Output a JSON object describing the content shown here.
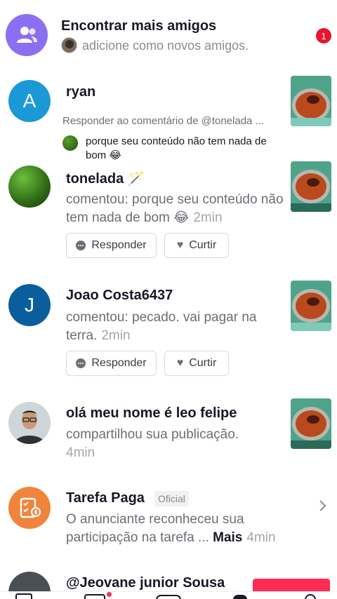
{
  "find_friends": {
    "title": "Encontrar mais amigos",
    "subtitle": "adicione como novos amigos.",
    "badge_count": "1",
    "accent": "#8c6ef2",
    "badge_color": "#e6162d"
  },
  "items": [
    {
      "letter": "A",
      "avatar_color": "#1b98d6",
      "name": "ryan",
      "context": "Responder ao comentário de @tonelada ...",
      "quote": "porque seu conteúdo não tem nada de bom 😂"
    },
    {
      "name": "tonelada 🪄",
      "comment": "comentou: porque seu conteúdo não tem nada de bom 😂",
      "time": "2min",
      "reply_label": "Responder",
      "like_label": "Curtir"
    },
    {
      "letter": "J",
      "avatar_color": "#0b5e9c",
      "name": "Joao Costa6437",
      "comment": "comentou: pecado. vai pagar na terra.",
      "time": "2min",
      "reply_label": "Responder",
      "like_label": "Curtir"
    },
    {
      "name": "olá meu nome é leo felipe",
      "comment": "compartilhou sua publicação.",
      "time": "4min"
    },
    {
      "name": "Tarefa Paga",
      "official_label": "Oficial",
      "comment": "O anunciante reconheceu sua participação na tarefa ...",
      "more": "Mais",
      "time": "4min",
      "avatar_color": "#f0843c"
    },
    {
      "name": "@Jeovane junior Sousa"
    }
  ]
}
